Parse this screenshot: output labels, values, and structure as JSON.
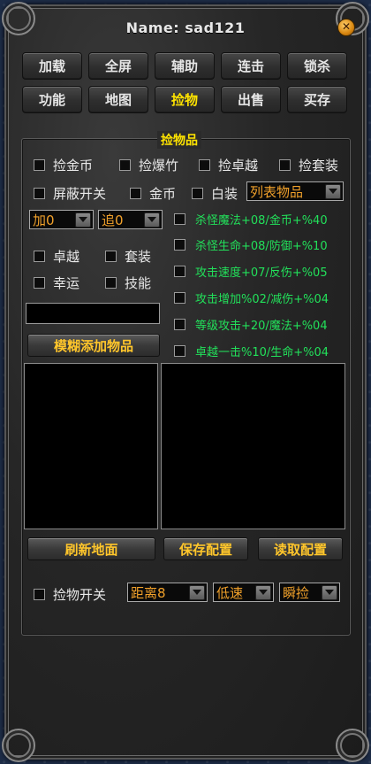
{
  "window": {
    "title": "Name:  sad121",
    "close_glyph": "✕"
  },
  "tabs": [
    {
      "label": "加载"
    },
    {
      "label": "全屏"
    },
    {
      "label": "辅助"
    },
    {
      "label": "连击"
    },
    {
      "label": "锁杀"
    },
    {
      "label": "功能"
    },
    {
      "label": "地图"
    },
    {
      "label": "捡物",
      "active": true
    },
    {
      "label": "出售"
    },
    {
      "label": "买存"
    }
  ],
  "pickup": {
    "group_title": "捡物品",
    "row1": [
      "捡金币",
      "捡爆竹",
      "捡卓越",
      "捡套装"
    ],
    "row2": [
      "屏蔽开关",
      "金币",
      "白装"
    ],
    "list_dropdown": "列表物品",
    "add_dropdown": "加0",
    "chase_dropdown": "追0",
    "options": [
      "卓越",
      "套装",
      "幸运",
      "技能"
    ],
    "attributes": [
      "杀怪魔法+08/金币+%40",
      "杀怪生命+08/防御+%10",
      "攻击速度+07/反伤+%05",
      "攻击增加%02/减伤+%04",
      "等级攻击+20/魔法+%04",
      "卓越一击%10/生命+%04"
    ],
    "name_input_value": "",
    "fuzzy_add_button": "模糊添加物品",
    "refresh_button": "刷新地面",
    "save_button": "保存配置",
    "load_button": "读取配置",
    "pickup_switch": "捡物开关",
    "distance_dropdown": "距离8",
    "speed_dropdown": "低速",
    "mode_dropdown": "瞬捡"
  }
}
